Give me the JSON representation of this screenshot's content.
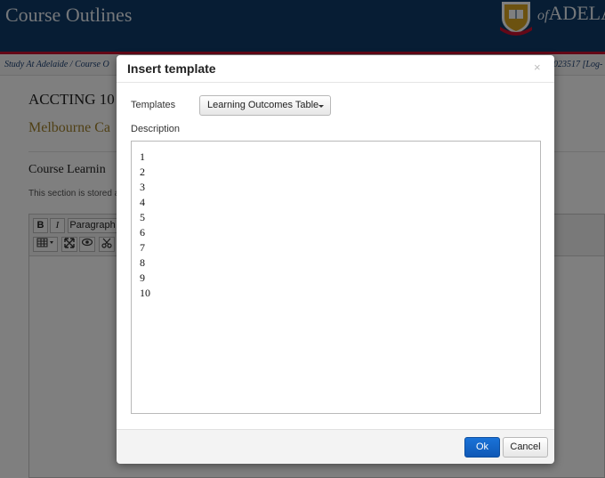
{
  "header": {
    "app_title": "Course Outlines",
    "brand_of": "of",
    "brand_name": "ADELA"
  },
  "breadcrumb": {
    "item1": "Study At Adelaide",
    "sep": " / ",
    "item2": "Course O",
    "user_info": "023517 [Log-"
  },
  "page": {
    "course_code": "ACCTING 10",
    "campus": "Melbourne Ca",
    "section_title": "Course Learnin",
    "section_note": "This section is stored a"
  },
  "editor": {
    "bold_label": "B",
    "italic_label": "I",
    "format_label": "Paragraph"
  },
  "modal": {
    "title": "Insert template",
    "close_glyph": "×",
    "templates_label": "Templates",
    "template_selected": "Learning Outcomes Table",
    "description_label": "Description",
    "description_lines": [
      "1",
      "2",
      "3",
      "4",
      "5",
      "6",
      "7",
      "8",
      "9",
      "10"
    ],
    "ok_label": "Ok",
    "cancel_label": "Cancel"
  },
  "colors": {
    "header_bg": "#0f3b68",
    "header_border": "#c8102e",
    "campus_text": "#a0802a",
    "primary_button": "#1565c8"
  }
}
